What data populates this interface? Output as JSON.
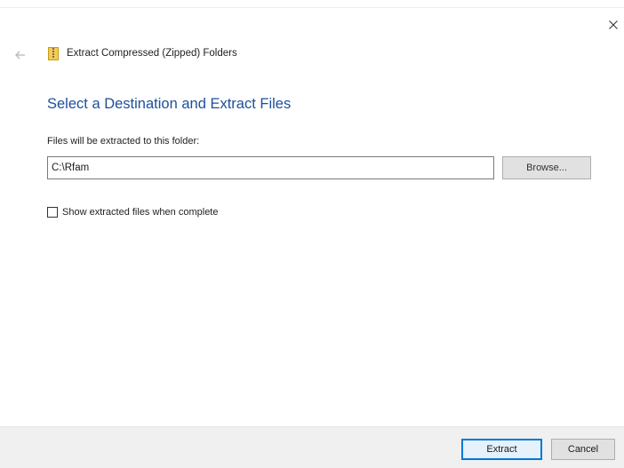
{
  "window": {
    "title": "Extract Compressed (Zipped) Folders",
    "icon": "zipped-folder-icon"
  },
  "nav": {
    "back_icon": "back-arrow-icon",
    "close_icon": "close-icon"
  },
  "main": {
    "heading": "Select a Destination and Extract Files",
    "destination_label": "Files will be extracted to this folder:",
    "destination_value": "C:\\Rfam",
    "browse_label": "Browse...",
    "show_files_label": "Show extracted files when complete",
    "show_files_checked": false
  },
  "footer": {
    "extract_label": "Extract",
    "cancel_label": "Cancel"
  },
  "colors": {
    "heading": "#1e4f9a",
    "accent": "#0078d7",
    "footer_background": "#f0f0f0",
    "zip_icon": "#f2c94c"
  }
}
